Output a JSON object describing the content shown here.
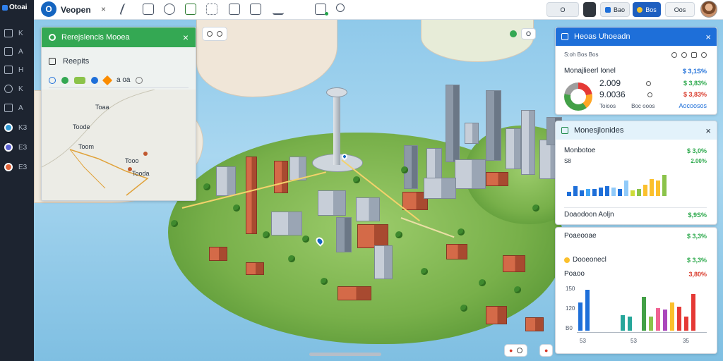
{
  "rail": {
    "brand": "Otoai",
    "items": [
      {
        "icon": "folder-icon",
        "label": "K"
      },
      {
        "icon": "layers-icon",
        "label": "A"
      },
      {
        "icon": "table-icon",
        "label": "H"
      },
      {
        "icon": "globe-icon",
        "label": "K"
      },
      {
        "icon": "chart-icon",
        "label": "A"
      },
      {
        "icon": "app-blue-icon",
        "label": "K3",
        "color": "#2f9bd6"
      },
      {
        "icon": "app-purple-icon",
        "label": "E3",
        "color": "#5b63d6"
      },
      {
        "icon": "app-orange-icon",
        "label": "E3",
        "color": "#e2643a"
      }
    ]
  },
  "topbar": {
    "logo": "O",
    "title": "Veopen",
    "close": "×",
    "pill_a": "O",
    "pill_b": "Bao",
    "pill_c": "Bos",
    "pill_d": "Oos"
  },
  "map": {
    "pill": "O"
  },
  "route_panel": {
    "title": "Rerejslencis Mooea",
    "close": "×",
    "search": "Reepits",
    "modes": "a oa",
    "labels": [
      "Toaa",
      "Toode",
      "Toom",
      "Tooo",
      "Tooda"
    ]
  },
  "card1": {
    "title": "Heoas Uhoeadn",
    "close": "×",
    "subtitle": "S:oh Bos Bos",
    "row1_label": "Monajlieerl Ionel",
    "row1_value": "$ 3,1S%",
    "row2_label": "2.009",
    "row2_value": "$ 3,83%",
    "row3_label": "9.0036",
    "row3_value": "$ 3,83%",
    "foot_a": "Toioos",
    "foot_b": "Boc ooos",
    "foot_c": "Aocoosos"
  },
  "card2": {
    "title": "Monesjlonides",
    "close": "×",
    "row1_label": "Monbotoe",
    "row1_value": "$ 3,0%",
    "row2_label": "S8",
    "row2_value": "2.00%",
    "footer_label": "Doaodoon Aoljn",
    "footer_value": "$,9S%"
  },
  "card3": {
    "row1_label": "Poaeooae",
    "row1_value": "$ 3,3%",
    "row2_label": "Dooeonecl",
    "row2_value": "$ 3,3%",
    "row3_label": "Poaoo",
    "row3_value": "3,80%",
    "axis_top": "150",
    "axis_mid": "120",
    "axis_bot": "B0",
    "x1": "53",
    "x2": "53",
    "x3": "35"
  },
  "colors": {
    "primary": "#1e6fd9",
    "success": "#34a853",
    "danger": "#d93a2b",
    "rail": "#1d2430"
  }
}
